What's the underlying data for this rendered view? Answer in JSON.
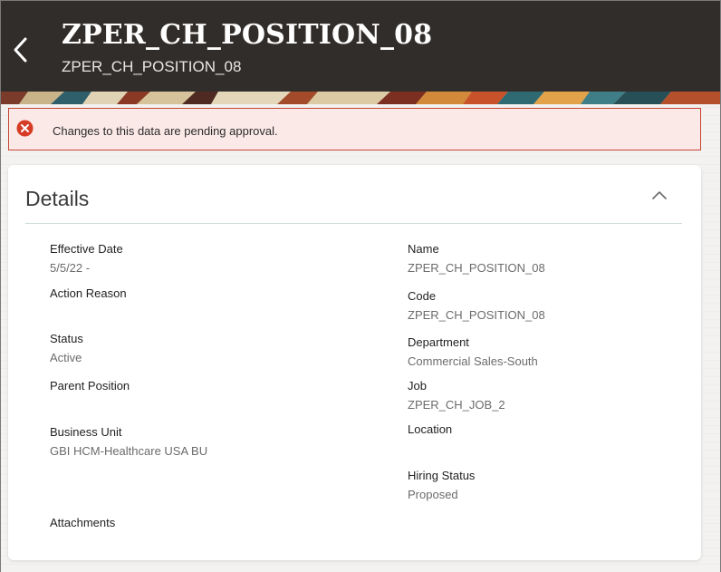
{
  "header": {
    "title": "ZPER_CH_POSITION_08",
    "subtitle": "ZPER_CH_POSITION_08"
  },
  "alert": {
    "message": "Changes to this data are pending approval."
  },
  "details": {
    "title": "Details",
    "left": [
      {
        "label": "Effective Date",
        "value": "5/5/22 -"
      },
      {
        "label": "Action Reason",
        "value": ""
      },
      {
        "label": "Status",
        "value": "Active"
      },
      {
        "label": "Parent Position",
        "value": ""
      },
      {
        "label": "Business Unit",
        "value": "GBI HCM-Healthcare USA BU"
      },
      {
        "label": "Attachments",
        "value": ""
      }
    ],
    "right": [
      {
        "label": "Name",
        "value": "ZPER_CH_POSITION_08"
      },
      {
        "label": "Code",
        "value": "ZPER_CH_POSITION_08"
      },
      {
        "label": "Department",
        "value": "Commercial Sales-South"
      },
      {
        "label": "Job",
        "value": "ZPER_CH_JOB_2"
      },
      {
        "label": "Location",
        "value": ""
      },
      {
        "label": "Hiring Status",
        "value": "Proposed"
      }
    ]
  },
  "colors": {
    "header_bg": "#312d2a",
    "alert_border": "#c74634",
    "alert_bg": "#fbe9e8",
    "error_icon": "#d63b25"
  },
  "icons": {
    "back": "chevron-left-icon",
    "error": "error-circle-icon",
    "collapse": "chevron-up-icon"
  }
}
